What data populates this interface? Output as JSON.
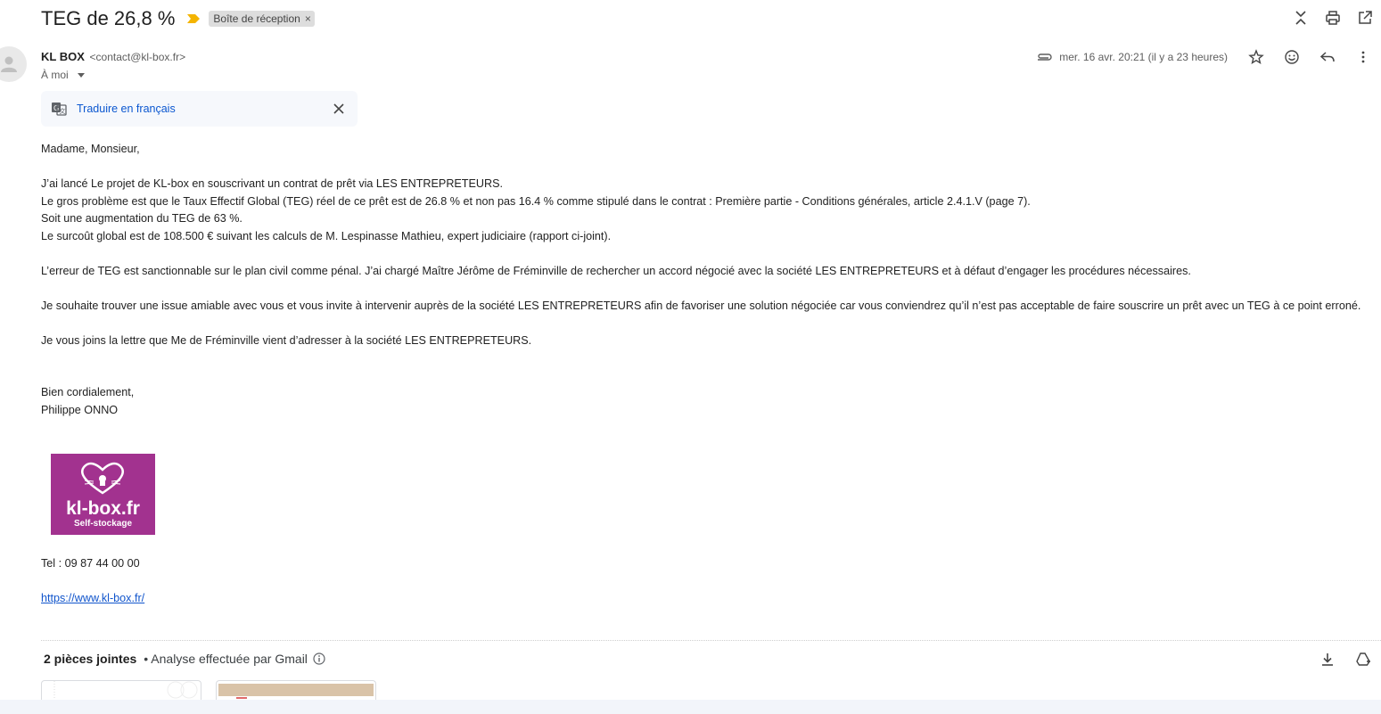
{
  "email": {
    "subject": "TEG de 26,8 %",
    "label": "Boîte de réception",
    "label_remove": "×",
    "sender_name": "KL BOX",
    "sender_email": "<contact@kl-box.fr>",
    "to": "À moi",
    "date": "mer. 16 avr. 20:21 (il y a 23 heures)"
  },
  "translate": {
    "link_label": "Traduire en français"
  },
  "body": {
    "greeting": "Madame, Monsieur,",
    "p1_l1": "J’ai lancé Le projet de KL-box en souscrivant un contrat de prêt via LES ENTREPRETEURS.",
    "p1_l2": "Le gros problème est que le Taux Effectif Global (TEG) réel de ce prêt est de 26.8 % et non pas 16.4 % comme stipulé dans le contrat : Première partie - Conditions générales, article 2.4.1.V (page 7).",
    "p1_l3": "Soit une augmentation du TEG de 63 %.",
    "p1_l4": "Le surcoût global est de 108.500 € suivant les calculs de M. Lespinasse Mathieu, expert judiciaire (rapport ci-joint).",
    "p2": "L’erreur de TEG est sanctionnable sur le plan civil comme pénal. J’ai chargé Maître Jérôme de Fréminville de rechercher un accord négocié avec la société LES ENTREPRETEURS et à défaut d’engager les procédures nécessaires.",
    "p3": "Je souhaite trouver une issue amiable avec vous et vous invite à intervenir auprès de la société LES ENTREPRETEURS afin de favoriser une solution négociée car vous conviendrez qu’il n’est pas acceptable de faire souscrire un prêt avec un TEG à ce point erroné.",
    "p4": "Je vous joins la lettre que Me de Fréminville vient d’adresser à la société LES ENTREPRETEURS.",
    "closing": "Bien cordialement,",
    "signature": "Philippe ONNO",
    "logo_text": "kl-box.fr",
    "logo_subtext": "Self-stockage",
    "phone": "Tel : 09 87 44 00 00",
    "website": "https://www.kl-box.fr/"
  },
  "attachments": {
    "title": "2 pièces jointes",
    "scan_note": "• Analyse effectuée par Gmail"
  },
  "colors": {
    "link": "#0b57d0",
    "importance": "#f4b400",
    "logo_bg": "#a2328f",
    "label_bg": "#dddddd"
  },
  "icons": [
    "collapse-icon",
    "print-icon",
    "open-new-window-icon",
    "attachment-icon",
    "star-icon",
    "emoji-icon",
    "reply-icon",
    "more-vert-icon",
    "translate-icon",
    "close-icon",
    "info-icon",
    "download-icon",
    "add-to-drive-icon"
  ]
}
